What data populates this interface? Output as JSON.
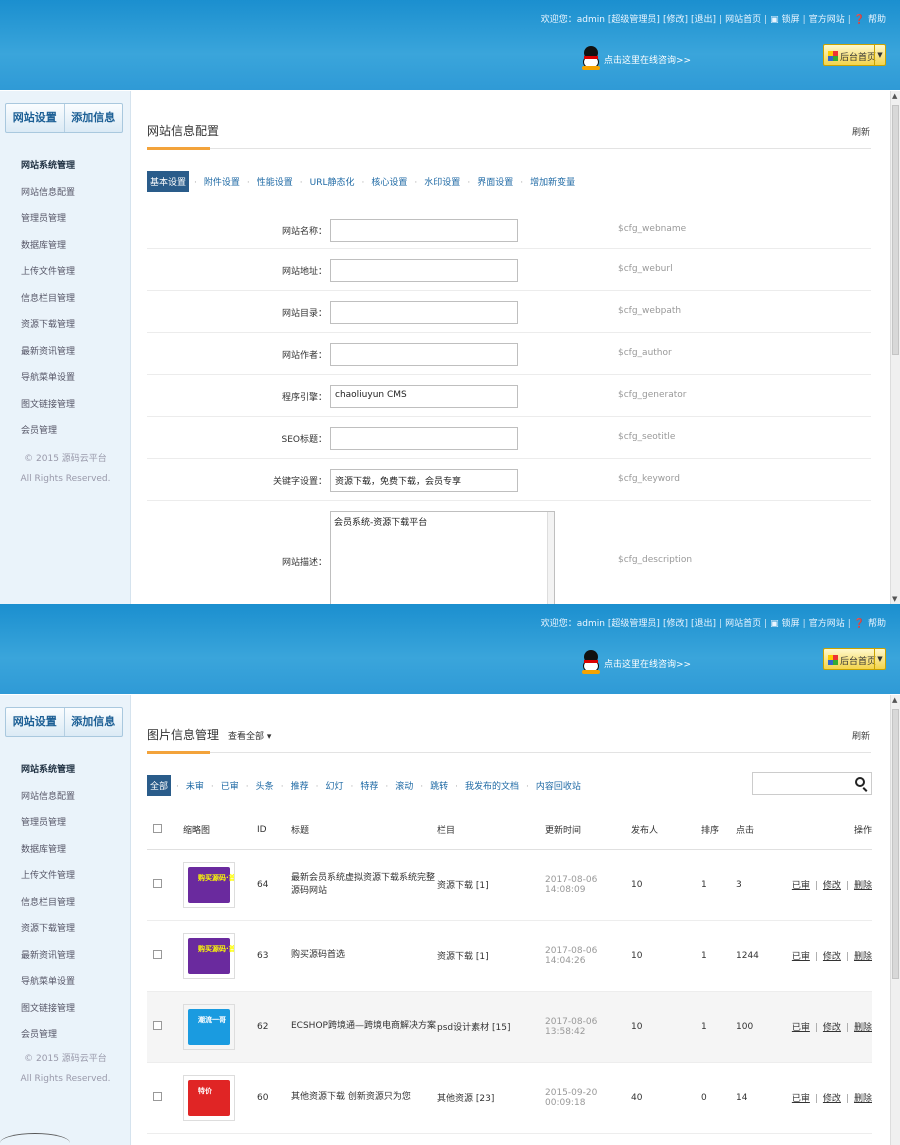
{
  "header": {
    "welcome": "欢迎您：admin",
    "role": "[超级管理员]",
    "edit_link": "[修改]",
    "logout_link": "[退出]",
    "site_home": "网站首页",
    "lock": "锁屏",
    "official_site": "官方网站",
    "help": "帮助",
    "qq_text": "点击这里在线咨询>>",
    "admin_home_button": "后台首页"
  },
  "sidebar": {
    "tab_settings": "网站设置",
    "tab_add": "添加信息",
    "items": [
      "网站系统管理",
      "网站信息配置",
      "管理员管理",
      "数据库管理",
      "上传文件管理",
      "信息栏目管理",
      "资源下载管理",
      "最新资讯管理",
      "导航菜单设置",
      "图文链接管理",
      "会员管理"
    ],
    "copyright": "© 2015 源码云平台",
    "rights": "All Rights Reserved."
  },
  "config_page": {
    "title": "网站信息配置",
    "refresh": "刷新",
    "tabs": [
      "基本设置",
      "附件设置",
      "性能设置",
      "URL静态化",
      "核心设置",
      "水印设置",
      "界面设置",
      "增加新变量"
    ],
    "fields": [
      {
        "label": "网站名称：",
        "value": "",
        "var": "$cfg_webname"
      },
      {
        "label": "网站地址：",
        "value": "",
        "var": "$cfg_weburl"
      },
      {
        "label": "网站目录：",
        "value": "",
        "var": "$cfg_webpath"
      },
      {
        "label": "网站作者：",
        "value": "",
        "var": "$cfg_author"
      },
      {
        "label": "程序引擎：",
        "value": "chaoliuyun CMS",
        "var": "$cfg_generator"
      },
      {
        "label": "SEO标题：",
        "value": "",
        "var": "$cfg_seotitle"
      },
      {
        "label": "关键字设置：",
        "value": "资源下载，免费下载，会员专享",
        "var": "$cfg_keyword"
      }
    ],
    "description": {
      "label": "网站描述：",
      "value": "会员系统-资源下载平台",
      "var": "$cfg_description"
    }
  },
  "image_page": {
    "title": "图片信息管理",
    "view_all": "查看全部",
    "refresh": "刷新",
    "filters": [
      "全部",
      "未审",
      "已审",
      "头条",
      "推荐",
      "幻灯",
      "特荐",
      "滚动",
      "跳转",
      "我发布的文档",
      "内容回收站"
    ],
    "search_placeholder": "",
    "columns": [
      "",
      "缩略图",
      "ID",
      "标题",
      "栏目",
      "更新时间",
      "发布人",
      "排序",
      "点击",
      "操作"
    ],
    "rows": [
      {
        "id": "64",
        "title": "最新会员系统虚拟资源下载系统完整源码网站",
        "column": "资源下载 [1]",
        "time": "2017-08-06 14:08:09",
        "author": "10",
        "order": "1",
        "clicks": "3",
        "thumb_color": "#6a2a9e",
        "thumb_text": "购买源码·首选"
      },
      {
        "id": "63",
        "title": "购买源码首选",
        "column": "资源下载 [1]",
        "time": "2017-08-06 14:04:26",
        "author": "10",
        "order": "1",
        "clicks": "1244",
        "thumb_color": "#6a2a9e",
        "thumb_text": "购买源码·首选"
      },
      {
        "id": "62",
        "title": "ECSHOP跨境通—跨境电商解决方案",
        "column": "psd设计素材 [15]",
        "time": "2017-08-06 13:58:42",
        "author": "10",
        "order": "1",
        "clicks": "100",
        "thumb_color": "#1a9be0",
        "thumb_text": "潮流一哥"
      },
      {
        "id": "60",
        "title": "其他资源下载 创新资源只为您",
        "column": "其他资源 [23]",
        "time": "2015-09-20 00:09:18",
        "author": "40",
        "order": "0",
        "clicks": "14",
        "thumb_color": "#e02525",
        "thumb_text": "特价"
      }
    ],
    "op_reviewed": "已审",
    "op_edit": "修改",
    "op_delete": "删除"
  }
}
